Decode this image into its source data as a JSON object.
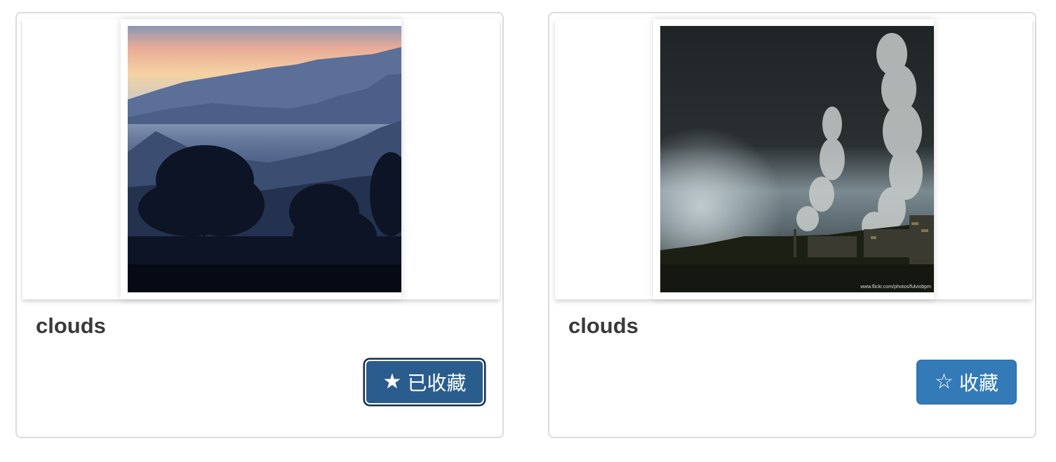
{
  "cards": [
    {
      "title": "clouds",
      "favorite_button": {
        "icon": "★",
        "label": "已收藏",
        "state": "favorited"
      }
    },
    {
      "title": "clouds",
      "favorite_button": {
        "icon": "☆",
        "label": "收藏",
        "state": "not-favorited"
      },
      "image_watermark": "www.flickr.com/photos/fulviobpm"
    }
  ],
  "colors": {
    "button_primary": "#337ab7",
    "button_active": "#2a5d8d",
    "card_border": "#dcdcdc",
    "title_text": "#3a3a3a"
  }
}
